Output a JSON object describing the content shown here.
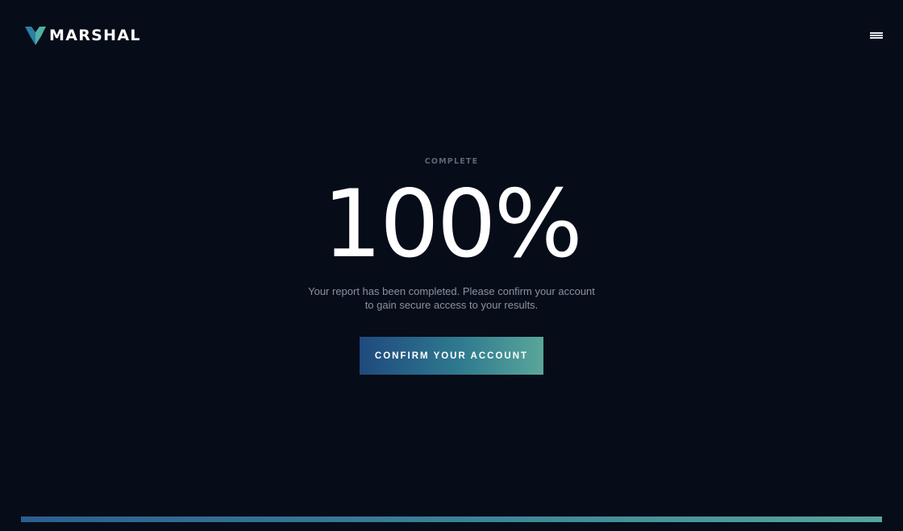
{
  "brand": {
    "name": "MARSHAL",
    "logo_icon": "marshal-shield-logo"
  },
  "header": {
    "menu_icon": "hamburger-menu-icon"
  },
  "status": {
    "label": "COMPLETE",
    "percent_text": "100%",
    "progress": 1.0
  },
  "message": {
    "text": "Your report has been completed. Please confirm your account to gain secure access to your results."
  },
  "cta": {
    "label": "CONFIRM YOUR ACCOUNT"
  },
  "colors": {
    "background": "#070c19",
    "accent_start": "#1f4a7e",
    "accent_end": "#5aa69a",
    "text_primary": "#ffffff",
    "text_muted": "#8a91a0"
  }
}
